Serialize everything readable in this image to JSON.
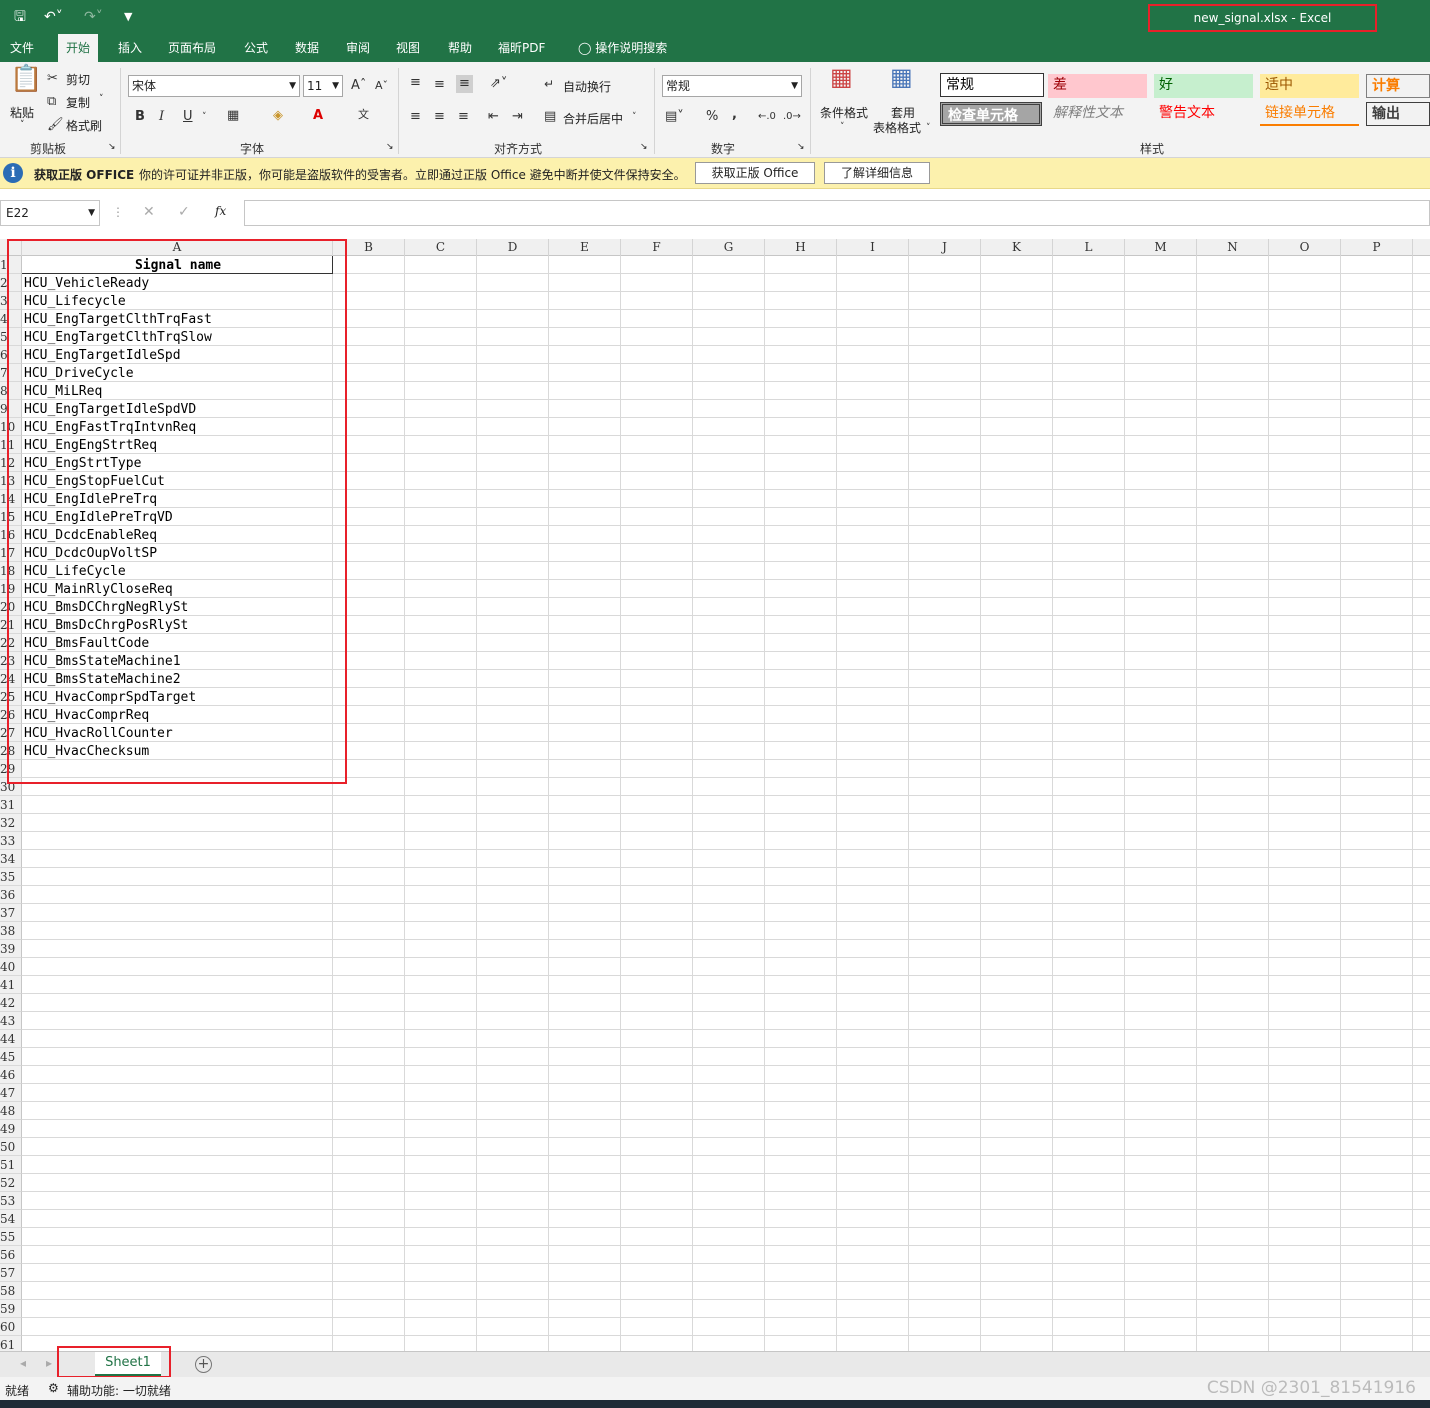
{
  "window": {
    "title": "new_signal.xlsx  -  Excel"
  },
  "ribbon_tabs": [
    "文件",
    "开始",
    "插入",
    "页面布局",
    "公式",
    "数据",
    "审阅",
    "视图",
    "帮助",
    "福昕PDF"
  ],
  "tell_me": "操作说明搜索",
  "clipboard": {
    "paste": "粘贴",
    "cut": "剪切",
    "copy": "复制",
    "format_painter": "格式刷",
    "label": "剪贴板"
  },
  "font": {
    "name": "宋体",
    "size": "11",
    "label": "字体"
  },
  "alignment": {
    "wrap": "自动换行",
    "merge": "合并后居中",
    "label": "对齐方式"
  },
  "number": {
    "format": "常规",
    "percent": "%",
    "comma": ",",
    "label": "数字"
  },
  "styles_group": {
    "conditional": "条件格式",
    "table_line1": "套用",
    "table_line2": "表格格式",
    "label": "样式",
    "cells": [
      {
        "text": "常规",
        "bg": "#ffffff",
        "fg": "#000000"
      },
      {
        "text": "差",
        "bg": "#ffc7ce",
        "fg": "#9c0006"
      },
      {
        "text": "好",
        "bg": "#c6efce",
        "fg": "#006100"
      },
      {
        "text": "适中",
        "bg": "#ffeb9c",
        "fg": "#9c5700"
      },
      {
        "text": "计算",
        "bg": "#f2f2f2",
        "fg": "#fa7d00"
      },
      {
        "text": "检查单元格",
        "bg": "#a5a5a5",
        "fg": "#ffffff"
      },
      {
        "text": "解释性文本",
        "bg": "#f3f3f3",
        "fg": "#7f7f7f"
      },
      {
        "text": "警告文本",
        "bg": "#f3f3f3",
        "fg": "#ff0000"
      },
      {
        "text": "链接单元格",
        "bg": "#f3f3f3",
        "fg": "#fa7d00"
      },
      {
        "text": "输出",
        "bg": "#f2f2f2",
        "fg": "#3f3f3f"
      }
    ]
  },
  "message_bar": {
    "title": "获取正版 OFFICE",
    "text": "你的许可证并非正版，你可能是盗版软件的受害者。立即通过正版 Office 避免中断并使文件保持安全。",
    "btn_get": "获取正版 Office",
    "btn_learn": "了解详细信息"
  },
  "formula_bar": {
    "name_box": "E22",
    "fx": "fx",
    "cancel": "✕",
    "enter": "✓"
  },
  "columns": [
    "A",
    "B",
    "C",
    "D",
    "E",
    "F",
    "G",
    "H",
    "I",
    "J",
    "K",
    "L",
    "M",
    "N",
    "O",
    "P"
  ],
  "row_numbers": [
    "1",
    "2",
    "3",
    "4",
    "5",
    "6",
    "7",
    "8",
    "9",
    "10",
    "11",
    "12",
    "13",
    "14",
    "15",
    "16",
    "17",
    "18",
    "19",
    "20",
    "21",
    "22",
    "23",
    "24",
    "25",
    "26",
    "27",
    "28",
    "29",
    "30",
    "31",
    "32",
    "33",
    "34",
    "35",
    "36",
    "37",
    "38",
    "39",
    "40",
    "41",
    "42",
    "43",
    "44",
    "45",
    "46",
    "47",
    "48",
    "49",
    "50",
    "51",
    "52",
    "53",
    "54",
    "55",
    "56",
    "57",
    "58",
    "59",
    "60",
    "61"
  ],
  "cells_a": [
    "Signal name",
    "HCU_VehicleReady",
    "HCU_Lifecycle",
    "HCU_EngTargetClthTrqFast",
    "HCU_EngTargetClthTrqSlow",
    "HCU_EngTargetIdleSpd",
    "HCU_DriveCycle",
    "HCU_MiLReq",
    "HCU_EngTargetIdleSpdVD",
    "HCU_EngFastTrqIntvnReq",
    "HCU_EngEngStrtReq",
    "HCU_EngStrtType",
    "HCU_EngStopFuelCut",
    "HCU_EngIdlePreTrq",
    "HCU_EngIdlePreTrqVD",
    "HCU_DcdcEnableReq",
    "HCU_DcdcOupVoltSP",
    "HCU_LifeCycle",
    "HCU_MainRlyCloseReq",
    "HCU_BmsDCChrgNegRlySt",
    "HCU_BmsDcChrgPosRlySt",
    "HCU_BmsFaultCode",
    "HCU_BmsStateMachine1",
    "HCU_BmsStateMachine2",
    "HCU_HvacComprSpdTarget",
    "HCU_HvacComprReq",
    "HCU_HvacRollCounter",
    "HCU_HvacChecksum"
  ],
  "sheet_tabs": [
    "Sheet1"
  ],
  "status": {
    "ready": "就绪",
    "accessibility": "辅助功能: 一切就绪"
  },
  "watermark": "CSDN @2301_81541916"
}
